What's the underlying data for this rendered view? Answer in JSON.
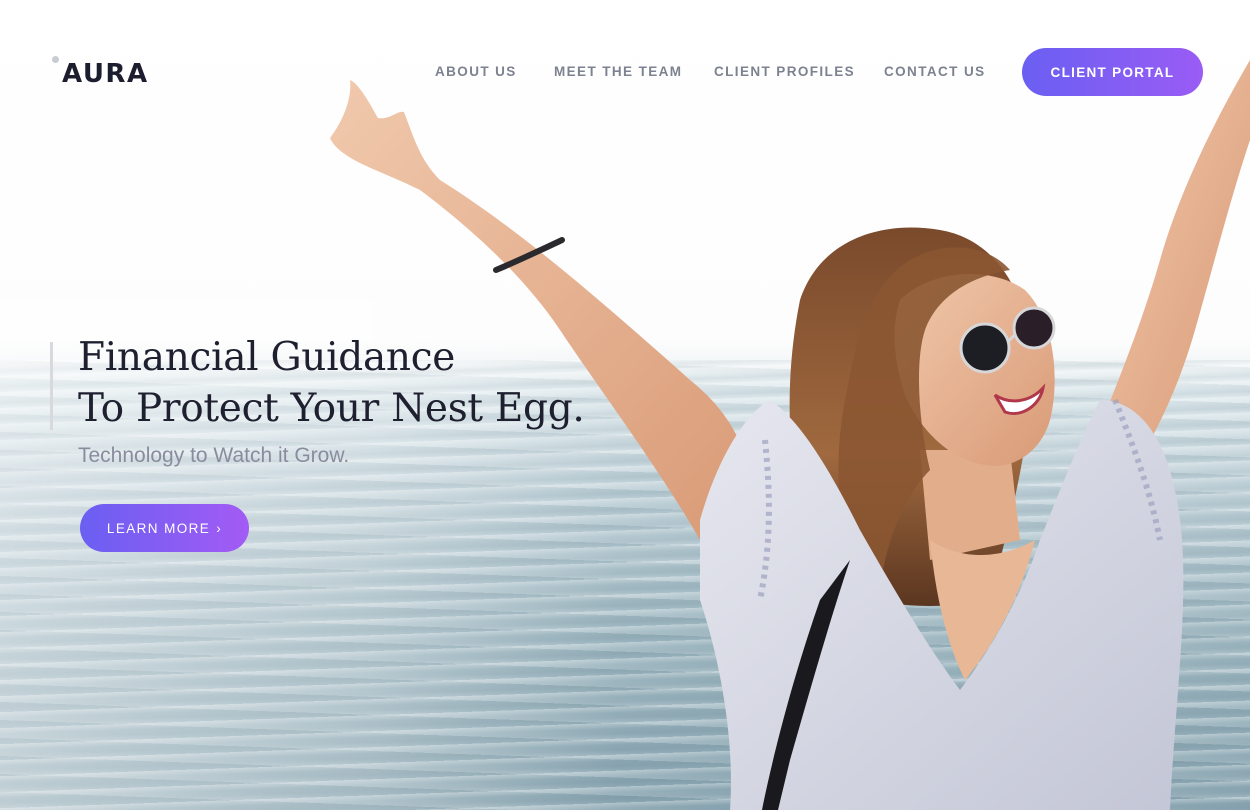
{
  "brand": {
    "name": "AURA"
  },
  "nav": {
    "items": [
      {
        "label": "ABOUT US"
      },
      {
        "label": "MEET THE TEAM"
      },
      {
        "label": "CLIENT PROFILES"
      },
      {
        "label": "CONTACT US"
      }
    ],
    "portal_label": "CLIENT PORTAL"
  },
  "hero": {
    "title_line1": "Financial Guidance",
    "title_line2": "To Protect Your Nest Egg.",
    "subtitle": "Technology to Watch it Grow.",
    "cta_label": "LEARN MORE",
    "cta_icon": "chevron-right-icon",
    "image": "woman-raising-arms-by-sea"
  },
  "colors": {
    "accent_start": "#6a5ff2",
    "accent_end": "#a35bf4",
    "heading": "#1e2030",
    "nav_text": "#7d8290",
    "subtitle": "#8a8c9e"
  }
}
